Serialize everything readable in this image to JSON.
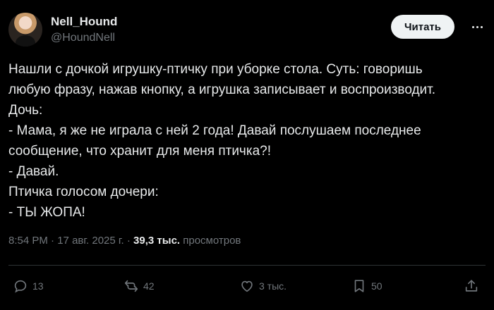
{
  "author": {
    "display_name": "Nell_Hound",
    "handle": "@HoundNell"
  },
  "follow_button": "Читать",
  "tweet_lines": [
    "Нашли с дочкой игрушку-птичку при уборке стола. Суть: говоришь",
    "любую фразу, нажав кнопку, а игрушка записывает и воспроизводит.",
    "Дочь:",
    "- Мама, я же не играла с ней 2 года! Давай послушаем последнее",
    "сообщение, что хранит для меня птичка?!",
    "- Давай.",
    "Птичка голосом дочери:",
    "- ТЫ ЖОПА!"
  ],
  "meta": {
    "time": "8:54 PM",
    "separator": "·",
    "date": "17 авг. 2025 г.",
    "views_count": "39,3 тыс.",
    "views_label": "просмотров"
  },
  "actions": {
    "replies": "13",
    "reposts": "42",
    "likes": "3 тыс.",
    "bookmarks": "50"
  },
  "icons": [
    "more-icon",
    "reply-icon",
    "repost-icon",
    "like-icon",
    "bookmark-icon",
    "share-icon"
  ],
  "colors": {
    "background": "#000000",
    "text": "#e7e9ea",
    "secondary": "#71767b",
    "divider": "#2f3336",
    "button_bg": "#eff3f4"
  }
}
